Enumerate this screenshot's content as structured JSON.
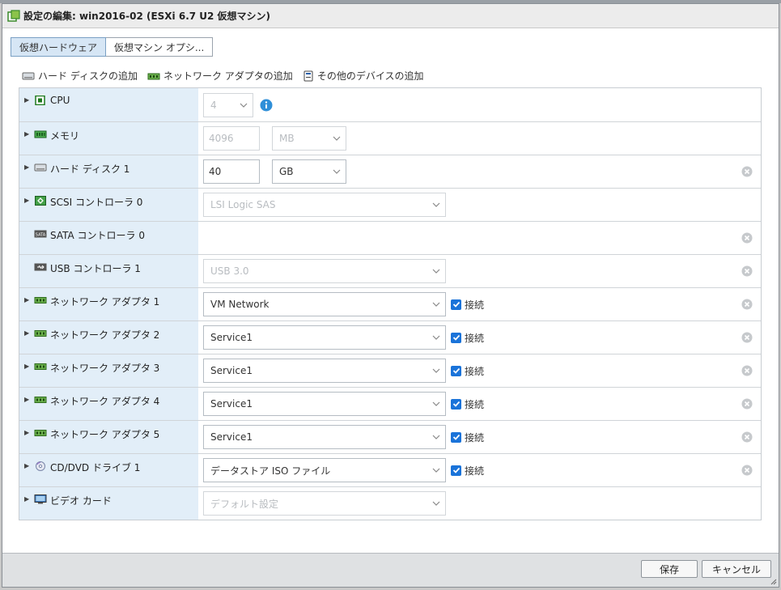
{
  "window": {
    "title": "設定の編集: win2016-02 (ESXi 6.7 U2 仮想マシン)"
  },
  "tabs": [
    {
      "label": "仮想ハードウェア",
      "active": true
    },
    {
      "label": "仮想マシン オプシ...",
      "active": false
    }
  ],
  "toolbar": {
    "add_disk": "ハード ディスクの追加",
    "add_nic": "ネットワーク アダプタの追加",
    "add_other": "その他のデバイスの追加"
  },
  "hardware": {
    "cpu": {
      "label": "CPU",
      "value": "4"
    },
    "memory": {
      "label": "メモリ",
      "value": "4096",
      "unit": "MB"
    },
    "disk1": {
      "label": "ハード ディスク 1",
      "value": "40",
      "unit": "GB"
    },
    "scsi": {
      "label": "SCSI コントローラ 0",
      "value": "LSI Logic SAS"
    },
    "sata": {
      "label": "SATA コントローラ 0"
    },
    "usb": {
      "label": "USB コントローラ 1",
      "value": "USB 3.0"
    },
    "nics": [
      {
        "label": "ネットワーク アダプタ 1",
        "value": "VM Network",
        "connect": "接続"
      },
      {
        "label": "ネットワーク アダプタ 2",
        "value": "Service1",
        "connect": "接続"
      },
      {
        "label": "ネットワーク アダプタ 3",
        "value": "Service1",
        "connect": "接続"
      },
      {
        "label": "ネットワーク アダプタ 4",
        "value": "Service1",
        "connect": "接続"
      },
      {
        "label": "ネットワーク アダプタ 5",
        "value": "Service1",
        "connect": "接続"
      }
    ],
    "cdrom": {
      "label": "CD/DVD ドライブ 1",
      "value": "データストア ISO ファイル",
      "connect": "接続"
    },
    "video": {
      "label": "ビデオ カード",
      "value": "デフォルト設定"
    }
  },
  "footer": {
    "save": "保存",
    "cancel": "キャンセル"
  },
  "colors": {
    "accent": "#1a73d9",
    "label_bg": "#e2eef8",
    "footer_bg": "#dfe1e3"
  }
}
